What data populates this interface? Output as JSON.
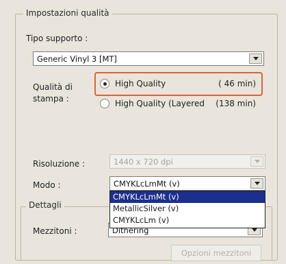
{
  "quality_settings": {
    "group_title": "Impostazioni qualità",
    "media_type": {
      "label": "Tipo supporto :",
      "value": "Generic Vinyl 3 [MT]"
    },
    "print_quality": {
      "label_line1": "Qualità di",
      "label_line2": "stampa :",
      "options": [
        {
          "label": "High Quality",
          "time": "( 46 min)",
          "selected": true
        },
        {
          "label": "High Quality (Layered",
          "time": "(138 min)",
          "selected": false
        }
      ]
    },
    "resolution": {
      "label": "Risoluzione :",
      "value": "1440 x 720 dpi"
    },
    "mode": {
      "label": "Modo :",
      "value": "CMYKLcLmMt (v)",
      "dropdown_options": [
        {
          "label": "CMYKLcLmMt (v)",
          "selected": true
        },
        {
          "label": "MetallicSilver (v)",
          "selected": false
        },
        {
          "label": "CMYKLcLm (v)",
          "selected": false
        }
      ]
    },
    "details": {
      "group_title": "Dettagli",
      "halftone": {
        "label": "Mezzitoni :",
        "value": "Dithering"
      },
      "halftone_options_button": "Opzioni mezzitoni"
    }
  }
}
